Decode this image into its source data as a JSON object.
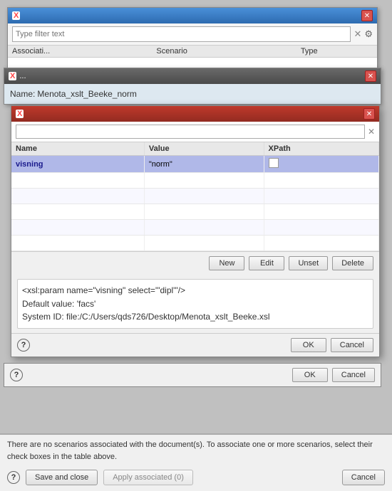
{
  "bg_window": {
    "title": "X",
    "filter_placeholder": "Type filter text",
    "columns": [
      "Associati...",
      "Scenario",
      "Type"
    ],
    "close_label": "✕"
  },
  "mid_window": {
    "title_icon": "X",
    "title_text": "...",
    "close_label": "✕",
    "name_label": "Name:",
    "name_value": "Menota_xslt_Beeke_norm"
  },
  "front_dialog": {
    "title_icon": "X",
    "title_text": "",
    "close_label": "✕",
    "search_placeholder": "",
    "table": {
      "headers": [
        "Name",
        "Value",
        "XPath"
      ],
      "rows": [
        {
          "name": "visning",
          "value": "\"norm\"",
          "xpath": false,
          "selected": true
        },
        {
          "name": "",
          "value": "",
          "xpath": false,
          "selected": false
        },
        {
          "name": "",
          "value": "",
          "xpath": false,
          "selected": false
        },
        {
          "name": "",
          "value": "",
          "xpath": false,
          "selected": false
        },
        {
          "name": "",
          "value": "",
          "xpath": false,
          "selected": false
        },
        {
          "name": "",
          "value": "",
          "xpath": false,
          "selected": false
        }
      ]
    },
    "buttons": {
      "new": "New",
      "edit": "Edit",
      "unset": "Unset",
      "delete": "Delete"
    },
    "info_text": "<xsl:param name=\"visning\" select=\"'dipl'\"/>\nDefault value: 'facs'\nSystem ID: file:/C:/Users/qds726/Desktop/Menota_xslt_Beeke.xsl",
    "ok_label": "OK",
    "cancel_label": "Cancel",
    "help_icon": "?"
  },
  "second_bar": {
    "help_icon": "?",
    "ok_label": "OK",
    "cancel_label": "Cancel"
  },
  "bottom_bar": {
    "warning": "There are no scenarios associated with the document(s). To associate one or more scenarios, select their check boxes in the table above.",
    "help_icon": "?",
    "save_close": "Save and close",
    "apply_associated": "Apply associated (0)",
    "cancel": "Cancel"
  }
}
